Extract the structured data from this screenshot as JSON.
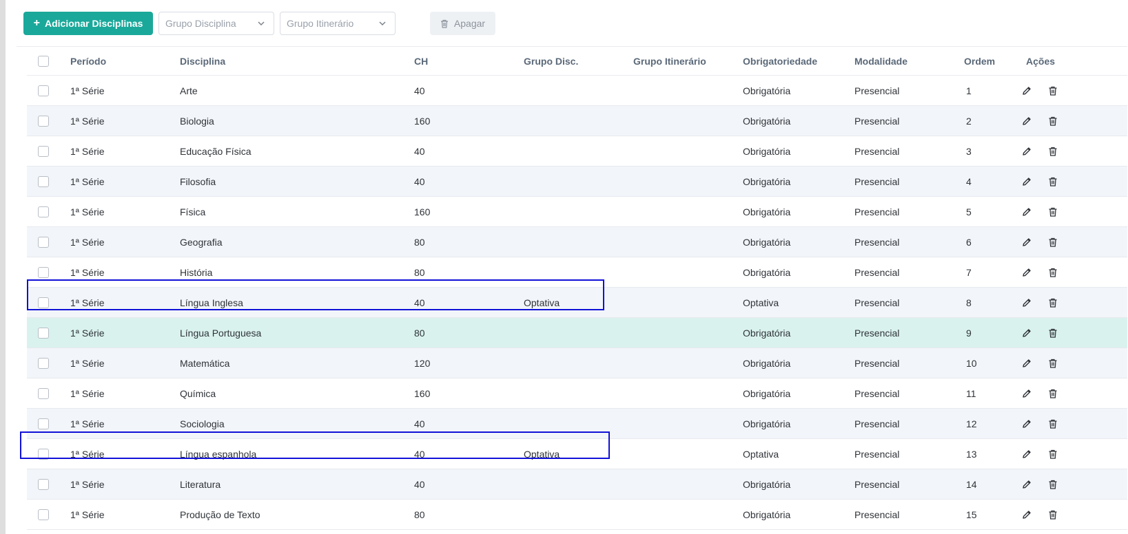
{
  "toolbar": {
    "add_label": "Adicionar Disciplinas",
    "grupo_disciplina_placeholder": "Grupo Disciplina",
    "grupo_itinerario_placeholder": "Grupo Itinerário",
    "delete_label": "Apagar"
  },
  "table": {
    "headers": {
      "periodo": "Período",
      "disciplina": "Disciplina",
      "ch": "CH",
      "grupo_disc": "Grupo Disc.",
      "grupo_itinerario": "Grupo Itinerário",
      "obrigatoriedade": "Obrigatoriedade",
      "modalidade": "Modalidade",
      "ordem": "Ordem",
      "acoes": "Ações"
    },
    "rows": [
      {
        "periodo": "1ª Série",
        "disciplina": "Arte",
        "ch": "40",
        "grupo_disc": "",
        "grupo_itinerario": "",
        "obrigatoriedade": "Obrigatória",
        "modalidade": "Presencial",
        "ordem": "1"
      },
      {
        "periodo": "1ª Série",
        "disciplina": "Biologia",
        "ch": "160",
        "grupo_disc": "",
        "grupo_itinerario": "",
        "obrigatoriedade": "Obrigatória",
        "modalidade": "Presencial",
        "ordem": "2"
      },
      {
        "periodo": "1ª Série",
        "disciplina": "Educação Física",
        "ch": "40",
        "grupo_disc": "",
        "grupo_itinerario": "",
        "obrigatoriedade": "Obrigatória",
        "modalidade": "Presencial",
        "ordem": "3"
      },
      {
        "periodo": "1ª Série",
        "disciplina": "Filosofia",
        "ch": "40",
        "grupo_disc": "",
        "grupo_itinerario": "",
        "obrigatoriedade": "Obrigatória",
        "modalidade": "Presencial",
        "ordem": "4"
      },
      {
        "periodo": "1ª Série",
        "disciplina": "Física",
        "ch": "160",
        "grupo_disc": "",
        "grupo_itinerario": "",
        "obrigatoriedade": "Obrigatória",
        "modalidade": "Presencial",
        "ordem": "5"
      },
      {
        "periodo": "1ª Série",
        "disciplina": "Geografia",
        "ch": "80",
        "grupo_disc": "",
        "grupo_itinerario": "",
        "obrigatoriedade": "Obrigatória",
        "modalidade": "Presencial",
        "ordem": "6"
      },
      {
        "periodo": "1ª Série",
        "disciplina": "História",
        "ch": "80",
        "grupo_disc": "",
        "grupo_itinerario": "",
        "obrigatoriedade": "Obrigatória",
        "modalidade": "Presencial",
        "ordem": "7"
      },
      {
        "periodo": "1ª Série",
        "disciplina": "Língua Inglesa",
        "ch": "40",
        "grupo_disc": "Optativa",
        "grupo_itinerario": "",
        "obrigatoriedade": "Optativa",
        "modalidade": "Presencial",
        "ordem": "8"
      },
      {
        "periodo": "1ª Série",
        "disciplina": "Língua Portuguesa",
        "ch": "80",
        "grupo_disc": "",
        "grupo_itinerario": "",
        "obrigatoriedade": "Obrigatória",
        "modalidade": "Presencial",
        "ordem": "9"
      },
      {
        "periodo": "1ª Série",
        "disciplina": "Matemática",
        "ch": "120",
        "grupo_disc": "",
        "grupo_itinerario": "",
        "obrigatoriedade": "Obrigatória",
        "modalidade": "Presencial",
        "ordem": "10"
      },
      {
        "periodo": "1ª Série",
        "disciplina": "Química",
        "ch": "160",
        "grupo_disc": "",
        "grupo_itinerario": "",
        "obrigatoriedade": "Obrigatória",
        "modalidade": "Presencial",
        "ordem": "11"
      },
      {
        "periodo": "1ª Série",
        "disciplina": "Sociologia",
        "ch": "40",
        "grupo_disc": "",
        "grupo_itinerario": "",
        "obrigatoriedade": "Obrigatória",
        "modalidade": "Presencial",
        "ordem": "12"
      },
      {
        "periodo": "1ª Série",
        "disciplina": "Língua espanhola",
        "ch": "40",
        "grupo_disc": "Optativa",
        "grupo_itinerario": "",
        "obrigatoriedade": "Optativa",
        "modalidade": "Presencial",
        "ordem": "13"
      },
      {
        "periodo": "1ª Série",
        "disciplina": "Literatura",
        "ch": "40",
        "grupo_disc": "",
        "grupo_itinerario": "",
        "obrigatoriedade": "Obrigatória",
        "modalidade": "Presencial",
        "ordem": "14"
      },
      {
        "periodo": "1ª Série",
        "disciplina": "Produção de Texto",
        "ch": "80",
        "grupo_disc": "",
        "grupo_itinerario": "",
        "obrigatoriedade": "Obrigatória",
        "modalidade": "Presencial",
        "ordem": "15"
      }
    ]
  },
  "colors": {
    "primary": "#1aa89a",
    "row_alt": "#f2f5f9",
    "row_hover": "#d9f2ee",
    "annotation_box": "#1010d8"
  },
  "icons": {
    "add": "plus-icon",
    "dropdown": "chevron-down-icon",
    "delete": "trash-icon",
    "edit": "pencil-icon"
  }
}
